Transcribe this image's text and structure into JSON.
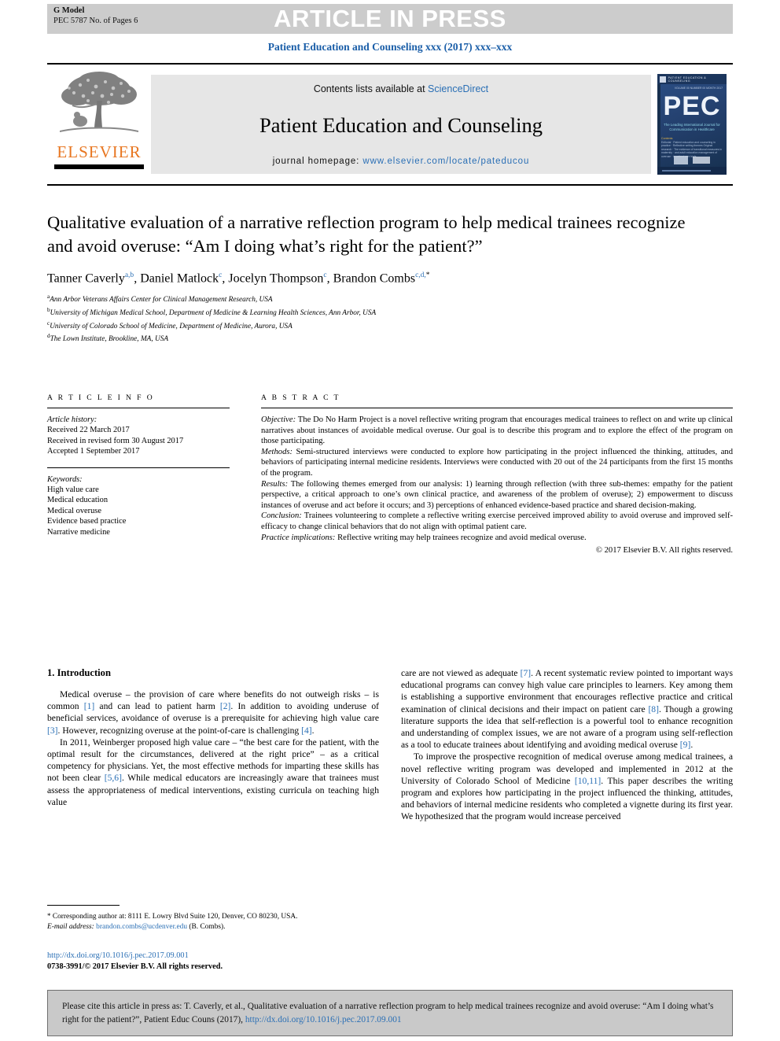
{
  "header": {
    "g_model": "G Model",
    "pec_pages": "PEC 5787 No. of Pages 6",
    "article_in_press": "ARTICLE IN PRESS",
    "journal_running_head": "Patient Education and Counseling xxx (2017) xxx–xxx"
  },
  "masthead": {
    "contents_prefix": "Contents lists available at ",
    "sciencedirect": "ScienceDirect",
    "journal_title": "Patient Education and Counseling",
    "homepage_label": "journal homepage: ",
    "homepage_url": "www.elsevier.com/locate/pateducou",
    "publisher": "ELSEVIER",
    "cover": {
      "masthead_small": "PATIENT EDUCATION & COUNSELING",
      "issue_line": "VOLUME 00  NUMBER 00\nMONTH 2017",
      "big": "PEC",
      "tagline": "The Leading International Journal\nfor Communication in Healthcare",
      "contents_head": "Contents",
      "contents_items": "Editorial\n  · Patient education and counseling in practice\n  · Reflective writing themes\nOriginal research\n  · The evidence of transitional measures in maternity\n  · and adult education management of overuse\n  · in patient care trials"
    }
  },
  "article": {
    "title": "Qualitative evaluation of a narrative reflection program to help medical trainees recognize and avoid overuse: “Am I doing what’s right for the patient?”",
    "authors": [
      {
        "name": "Tanner Caverly",
        "marks": "a,b"
      },
      {
        "name": "Daniel Matlock",
        "marks": "c"
      },
      {
        "name": "Jocelyn Thompson",
        "marks": "c"
      },
      {
        "name": "Brandon Combs",
        "marks": "c,d,"
      }
    ],
    "affiliations": [
      {
        "mark": "a",
        "text": "Ann Arbor Veterans Affairs Center for Clinical Management Research, USA"
      },
      {
        "mark": "b",
        "text": "University of Michigan Medical School, Department of Medicine & Learning Health Sciences, Ann Arbor, USA"
      },
      {
        "mark": "c",
        "text": "University of Colorado School of Medicine, Department of Medicine, Aurora, USA"
      },
      {
        "mark": "d",
        "text": "The Lown Institute, Brookline, MA, USA"
      }
    ]
  },
  "article_info": {
    "heading": "A R T I C L E   I N F O",
    "history_label": "Article history:",
    "history": [
      "Received 22 March 2017",
      "Received in revised form 30 August 2017",
      "Accepted 1 September 2017"
    ],
    "keywords_label": "Keywords:",
    "keywords": [
      "High value care",
      "Medical education",
      "Medical overuse",
      "Evidence based practice",
      "Narrative medicine"
    ]
  },
  "abstract": {
    "heading": "A B S T R A C T",
    "objective_label": "Objective:",
    "objective": " The Do No Harm Project is a novel reflective writing program that encourages medical trainees to reflect on and write up clinical narratives about instances of avoidable medical overuse. Our goal is to describe this program and to explore the effect of the program on those participating.",
    "methods_label": "Methods:",
    "methods": " Semi-structured interviews were conducted to explore how participating in the project influenced the thinking, attitudes, and behaviors of participating internal medicine residents. Interviews were conducted with 20 out of the 24 participants from the first 15 months of the program.",
    "results_label": "Results:",
    "results": " The following themes emerged from our analysis: 1) learning through reflection (with three sub-themes: empathy for the patient perspective, a critical approach to one’s own clinical practice, and awareness of the problem of overuse); 2) empowerment to discuss instances of overuse and act before it occurs; and 3) perceptions of enhanced evidence-based practice and shared decision-making.",
    "conclusion_label": "Conclusion:",
    "conclusion": " Trainees volunteering to complete a reflective writing exercise perceived improved ability to avoid overuse and improved self-efficacy to change clinical behaviors that do not align with optimal patient care.",
    "implications_label": "Practice implications:",
    "implications": " Reflective writing may help trainees recognize and avoid medical overuse.",
    "copyright": "© 2017 Elsevier B.V. All rights reserved."
  },
  "body": {
    "section_title": "1. Introduction",
    "left_paragraphs": [
      {
        "segments": [
          {
            "t": "Medical overuse – the provision of care where benefits do not outweigh risks – is common ",
            "k": "plain"
          },
          {
            "t": "[1]",
            "k": "ref"
          },
          {
            "t": " and can lead to patient harm ",
            "k": "plain"
          },
          {
            "t": "[2]",
            "k": "ref"
          },
          {
            "t": ". In addition to avoiding underuse of beneficial services, avoidance of overuse is a prerequisite for achieving high value care ",
            "k": "plain"
          },
          {
            "t": "[3]",
            "k": "ref"
          },
          {
            "t": ". However, recognizing overuse at the point-of-care is challenging ",
            "k": "plain"
          },
          {
            "t": "[4]",
            "k": "ref"
          },
          {
            "t": ".",
            "k": "plain"
          }
        ]
      },
      {
        "segments": [
          {
            "t": "In 2011, Weinberger proposed high value care – “the best care for the patient, with the optimal result for the circumstances, delivered at the right price” – as a critical competency for physicians. Yet, the most effective methods for imparting these skills has not been clear ",
            "k": "plain"
          },
          {
            "t": "[5,6]",
            "k": "ref"
          },
          {
            "t": ". While medical educators are increasingly aware that trainees must assess the appropriateness of medical interventions, existing curricula on teaching high value",
            "k": "plain"
          }
        ]
      }
    ],
    "right_paragraphs": [
      {
        "indent": false,
        "segments": [
          {
            "t": "care are not viewed as adequate ",
            "k": "plain"
          },
          {
            "t": "[7]",
            "k": "ref"
          },
          {
            "t": ". A recent systematic review pointed to important ways educational programs can convey high value care principles to learners. Key among them is establishing a supportive environment that encourages reflective practice and critical examination of clinical decisions and their impact on patient care ",
            "k": "plain"
          },
          {
            "t": "[8]",
            "k": "ref"
          },
          {
            "t": ". Though a growing literature supports the idea that self-reflection is a powerful tool to enhance recognition and understanding of complex issues, we are not aware of a program using self-reflection as a tool to educate trainees about identifying and avoiding medical overuse ",
            "k": "plain"
          },
          {
            "t": "[9]",
            "k": "ref"
          },
          {
            "t": ".",
            "k": "plain"
          }
        ]
      },
      {
        "indent": true,
        "segments": [
          {
            "t": "To improve the prospective recognition of medical overuse among medical trainees, a novel reflective writing program was developed and implemented in 2012 at the University of Colorado School of Medicine ",
            "k": "plain"
          },
          {
            "t": "[10,11]",
            "k": "ref"
          },
          {
            "t": ". This paper describes the writing program and explores how participating in the project influenced the thinking, attitudes, and behaviors of internal medicine residents who completed a vignette during its first year. We hypothesized that the program would increase perceived",
            "k": "plain"
          }
        ]
      }
    ]
  },
  "footnote": {
    "star": "*",
    "corresponding": " Corresponding author at: 8111 E. Lowry Blvd Suite 120, Denver, CO 80230, USA.",
    "email_label": "E-mail address:",
    "email": "brandon.combs@ucdenver.edu",
    "email_suffix": " (B. Combs)."
  },
  "doi_block": {
    "doi_url": "http://dx.doi.org/10.1016/j.pec.2017.09.001",
    "issn_line": "0738-3991/© 2017 Elsevier B.V. All rights reserved."
  },
  "cite_box": {
    "text_before": "Please cite this article in press as: T. Caverly, et al., Qualitative evaluation of a narrative reflection program to help medical trainees recognize and avoid overuse: “Am I doing what’s right for the patient?”, Patient Educ Couns (2017), ",
    "link": "http://dx.doi.org/10.1016/j.pec.2017.09.001"
  },
  "colors": {
    "link_blue": "#2a6fb5",
    "heading_blue": "#1a5ea8",
    "elsevier_orange": "#E87722",
    "band_gray": "#cccccc",
    "masthead_gray": "#e6e6e6",
    "cite_gray": "#c9c9c9"
  }
}
